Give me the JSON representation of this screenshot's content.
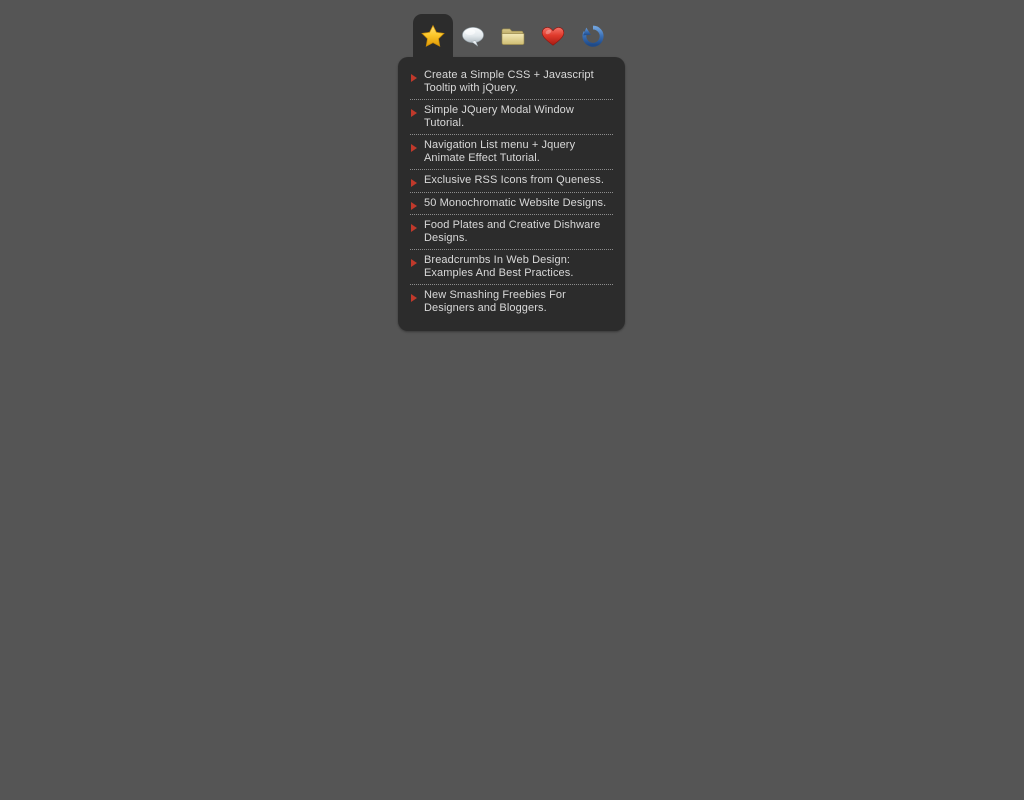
{
  "widget": {
    "background_color": "#555555",
    "panel_color": "#2c2c2c",
    "accent_color": "#c0392b",
    "text_color": "#d9d9d9",
    "tabs": [
      {
        "id": "favorites",
        "icon": "star-icon",
        "label": "Favorites",
        "active": true
      },
      {
        "id": "comments",
        "icon": "comment-icon",
        "label": "Comments",
        "active": false
      },
      {
        "id": "folder",
        "icon": "folder-icon",
        "label": "Folder",
        "active": false
      },
      {
        "id": "likes",
        "icon": "heart-icon",
        "label": "Likes",
        "active": false
      },
      {
        "id": "refresh",
        "icon": "refresh-icon",
        "label": "Refresh",
        "active": false
      }
    ],
    "items": [
      {
        "title": "Create a Simple CSS + Javascript Tooltip with jQuery."
      },
      {
        "title": "Simple JQuery Modal Window Tutorial."
      },
      {
        "title": "Navigation List menu + Jquery Animate Effect Tutorial."
      },
      {
        "title": "Exclusive RSS Icons from Queness."
      },
      {
        "title": "50 Monochromatic Website Designs."
      },
      {
        "title": "Food Plates and Creative Dishware Designs."
      },
      {
        "title": "Breadcrumbs In Web Design: Examples And Best Practices."
      },
      {
        "title": "New Smashing Freebies For Designers and Bloggers."
      }
    ]
  }
}
